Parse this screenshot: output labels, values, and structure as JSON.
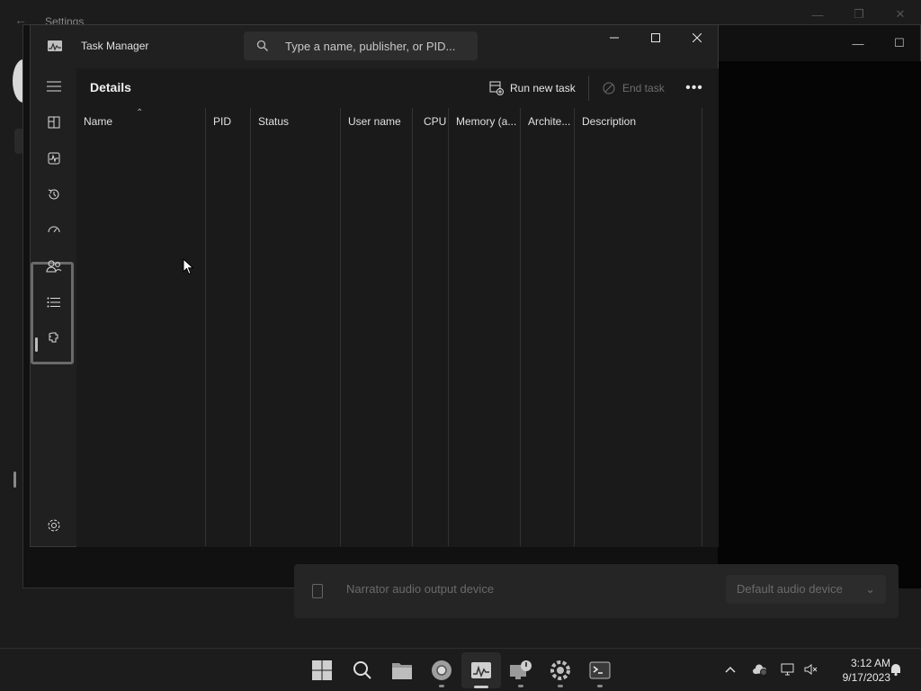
{
  "background": {
    "settings_title": "Settings",
    "narrator_row": {
      "label": "Narrator audio output device",
      "value": "Default audio device"
    }
  },
  "task_manager": {
    "title": "Task Manager",
    "search_placeholder": "Type a name, publisher, or PID...",
    "page_title": "Details",
    "commands": {
      "run_new_task": "Run new task",
      "end_task": "End task",
      "more": "•••"
    },
    "columns": [
      "Name",
      "PID",
      "Status",
      "User name",
      "CPU",
      "Memory (a...",
      "Archite...",
      "Description"
    ],
    "nav_items": [
      "hamburger-icon",
      "processes-icon",
      "performance-icon",
      "app-history-icon",
      "startup-apps-icon",
      "users-icon",
      "details-icon",
      "services-icon",
      "settings-icon"
    ],
    "active_nav": "details"
  },
  "taskbar": {
    "apps": [
      "start-icon",
      "search-icon",
      "file-explorer-icon",
      "chrome-icon",
      "task-manager-icon",
      "remote-desktop-icon",
      "settings-app-icon",
      "terminal-icon"
    ],
    "clock_time": "3:12 AM",
    "clock_date": "9/17/2023"
  },
  "colors": {
    "window_bg": "#202020",
    "content_bg": "#1a1a1a",
    "taskbar_bg": "#1c1c1c",
    "text": "#e0e0e0",
    "disabled_text": "#6e6e6e"
  }
}
